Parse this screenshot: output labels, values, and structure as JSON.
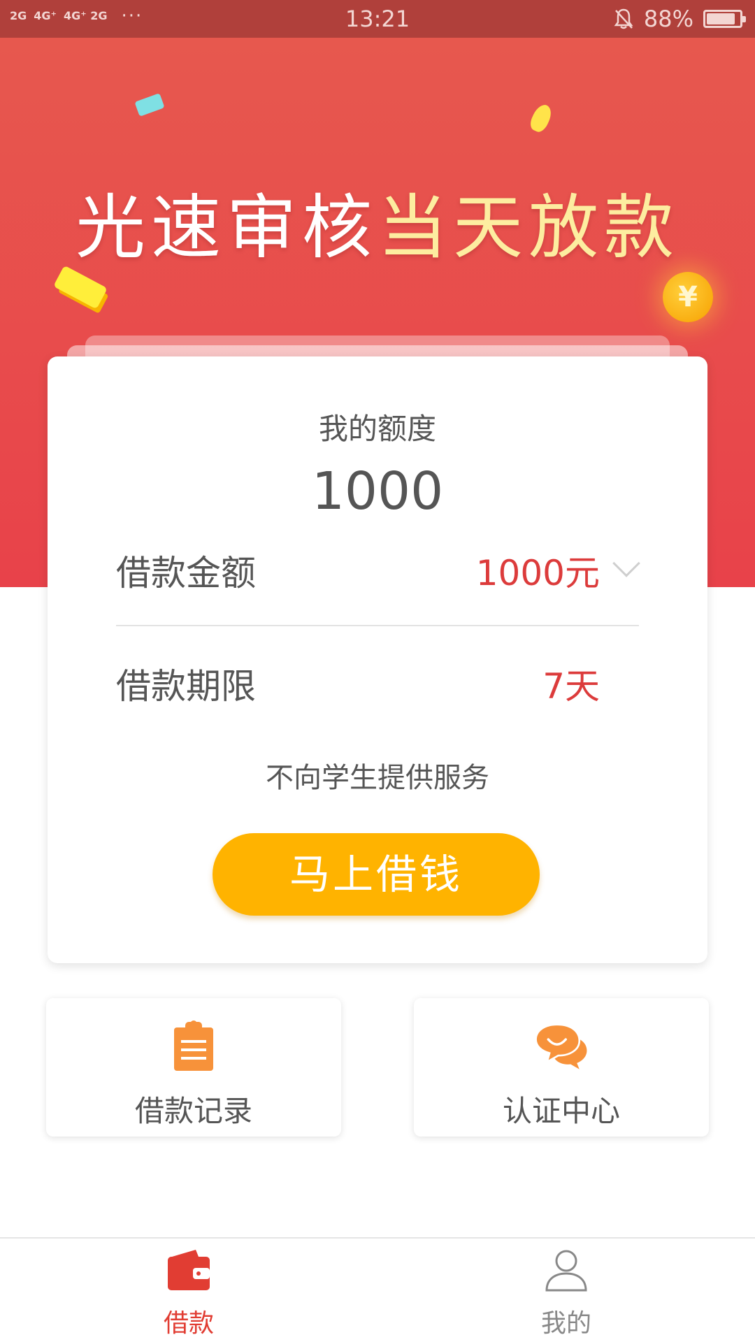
{
  "status_bar": {
    "signal1": "2G",
    "signal2": "4G⁺",
    "signal3": "4G⁺ 2G",
    "more": "···",
    "time": "13:21",
    "battery": "88%",
    "battery_level": 0.88
  },
  "hero": {
    "title_white": "光速审核",
    "title_highlight": "当天放款",
    "coin_symbol": "¥"
  },
  "card": {
    "quota_label": "我的额度",
    "quota_value": "1000",
    "amount_label": "借款金额",
    "amount_value": "1000元",
    "term_label": "借款期限",
    "term_value": "7天",
    "notice": "不向学生提供服务",
    "borrow_button": "马上借钱"
  },
  "tiles": {
    "records_label": "借款记录",
    "auth_label": "认证中心"
  },
  "bottom_nav": {
    "loan_label": "借款",
    "mine_label": "我的"
  },
  "colors": {
    "accent_red": "#e13d33",
    "button_yellow": "#ffb300",
    "icon_orange": "#f7923a",
    "value_red": "#dc3b3b"
  }
}
